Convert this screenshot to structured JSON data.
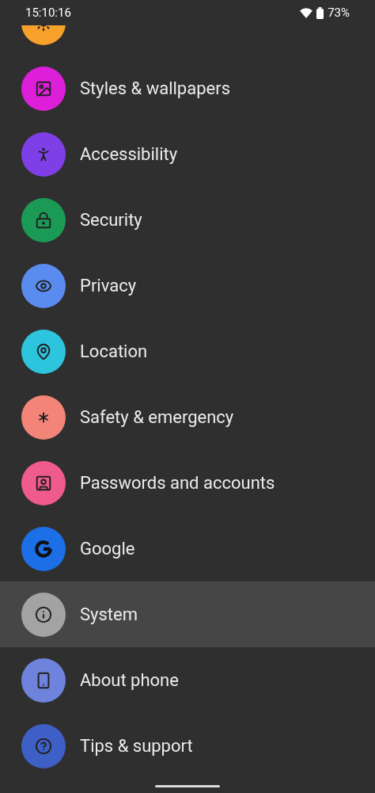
{
  "status_bar": {
    "time": "15:10:16",
    "battery": "73%"
  },
  "settings": [
    {
      "color": "#f7a12b",
      "selected": false
    },
    {
      "title": "Styles & wallpapers",
      "color": "#de1fd9",
      "selected": false
    },
    {
      "title": "Accessibility",
      "color": "#7f3fe6",
      "selected": false
    },
    {
      "title": "Security",
      "color": "#1b9a55",
      "selected": false
    },
    {
      "title": "Privacy",
      "color": "#5a8cef",
      "selected": false
    },
    {
      "title": "Location",
      "color": "#2cc5dd",
      "selected": false
    },
    {
      "title": "Safety & emergency",
      "color": "#f28478",
      "selected": false
    },
    {
      "title": "Passwords and accounts",
      "color": "#ef5b8c",
      "selected": false
    },
    {
      "title": "Google",
      "color": "#1c6fe6",
      "selected": false
    },
    {
      "title": "System",
      "color": "#a3a3a3",
      "selected": true
    },
    {
      "title": "About phone",
      "color": "#6d83dc",
      "selected": false
    },
    {
      "title": "Tips & support",
      "color": "#3e60c6",
      "selected": false
    }
  ]
}
